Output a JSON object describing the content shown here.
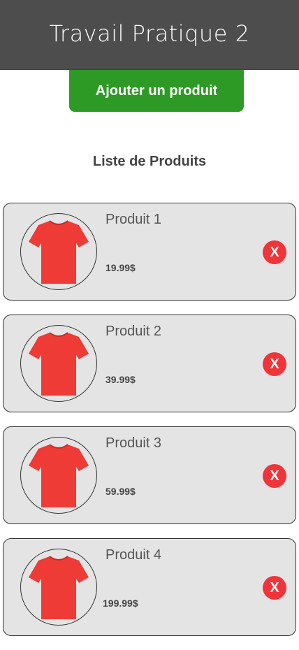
{
  "header": {
    "title": "Travail Pratique 2"
  },
  "toolbar": {
    "add_label": "Ajouter un produit"
  },
  "list": {
    "title": "Liste de Produits",
    "products": [
      {
        "name": "Produit 1",
        "price": "19.99$",
        "image_icon": "red-tshirt-icon",
        "delete_label": "X"
      },
      {
        "name": "Produit 2",
        "price": "39.99$",
        "image_icon": "red-tshirt-icon",
        "delete_label": "X"
      },
      {
        "name": "Produit 3",
        "price": "59.99$",
        "image_icon": "red-tshirt-icon",
        "delete_label": "X"
      },
      {
        "name": "Produit 4",
        "price": "199.99$",
        "image_icon": "red-tshirt-icon",
        "delete_label": "X"
      }
    ]
  },
  "colors": {
    "header_bg": "#4d4d4d",
    "add_button": "#2e9a26",
    "card_bg": "#e4e4e4",
    "delete_button": "#f0343a",
    "tshirt": "#ef3b36"
  }
}
